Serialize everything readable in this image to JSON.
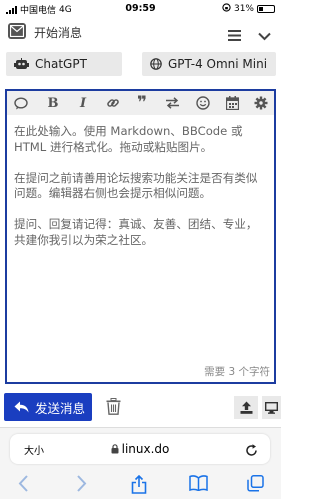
{
  "status_bar": {
    "carrier": "中国电信",
    "network": "4G",
    "time": "09:59",
    "battery": "31%",
    "battery_level": 0.31
  },
  "header": {
    "title": "开始消息"
  },
  "selectors": {
    "bot": "ChatGPT",
    "model": "GPT-4 Omni Mini"
  },
  "editor": {
    "placeholder_paragraphs": [
      "在此处输入。使用 Markdown、BBCode 或 HTML 进行格式化。拖动或粘贴图片。",
      "在提问之前请善用论坛搜索功能关注是否有类似问题。编辑器右侧也会提示相似问题。",
      "提问、回复请记得：真诚、友善、团结、专业，共建你我引以为荣之社区。"
    ],
    "char_counter": "需要 3 个字符",
    "toolbar": {
      "bold": "B",
      "italic": "I",
      "quote": "❞"
    }
  },
  "actions": {
    "send_label": "发送消息"
  },
  "browser": {
    "text_size": "大小",
    "url": "linux.do"
  },
  "icons": [
    "envelope-icon",
    "hamburger-icon",
    "chevron-down-icon",
    "robot-icon",
    "globe-icon",
    "chat-bubble-icon",
    "link-icon",
    "swap-icon",
    "smile-icon",
    "calendar-icon",
    "gear-icon",
    "reply-icon",
    "trash-icon",
    "upload-icon",
    "desktop-icon",
    "lock-icon",
    "reload-icon",
    "back-icon",
    "forward-icon",
    "share-icon",
    "bookmarks-icon",
    "tabs-icon"
  ],
  "colors": {
    "accent": "#1a3ec0",
    "editor_border": "#1c3ca0"
  }
}
